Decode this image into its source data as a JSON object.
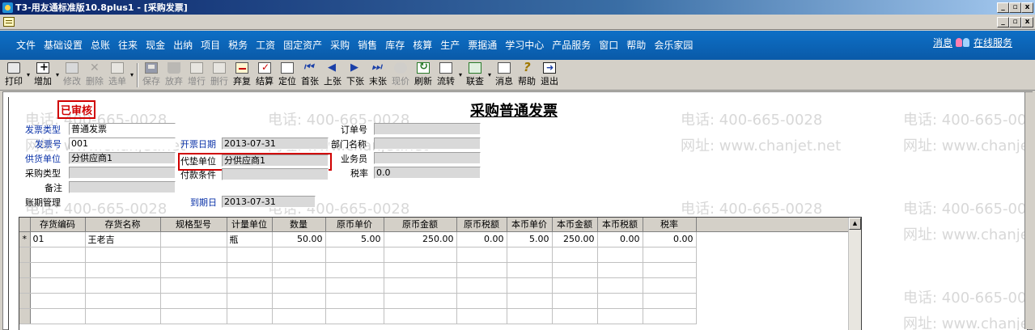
{
  "window": {
    "title": "T3-用友通标准版10.8plus1 - [采购发票]",
    "buttons": [
      "_",
      "▫",
      "x"
    ]
  },
  "inner_window": {
    "buttons": [
      "_",
      "▫",
      "x"
    ]
  },
  "menu": {
    "items": [
      "文件",
      "基础设置",
      "总账",
      "往来",
      "现金",
      "出纳",
      "项目",
      "税务",
      "工资",
      "固定资产",
      "采购",
      "销售",
      "库存",
      "核算",
      "生产",
      "票据通",
      "学习中心",
      "产品服务",
      "窗口",
      "帮助",
      "会乐家园"
    ],
    "message": "消息",
    "online_service": "在线服务"
  },
  "toolbar": {
    "print": "打印",
    "add": "增加",
    "modify": "修改",
    "delete": "删除",
    "select": "选单",
    "save": "保存",
    "discard": "放弃",
    "add_row": "增行",
    "delete_row": "删行",
    "abandon": "弃复",
    "settle": "结算",
    "locate": "定位",
    "first": "首张",
    "prev": "上张",
    "next": "下张",
    "last": "末张",
    "stock": "现价",
    "refresh": "刷新",
    "flow": "流转",
    "query": "联查",
    "message": "消息",
    "help": "帮助",
    "exit": "退出"
  },
  "watermark": {
    "phone": "电话: 400-665-0028",
    "site": "网址: www.chanjet.net"
  },
  "form": {
    "status_stamp": "已审核",
    "title": "采购普通发票",
    "invoice_type_label": "发票类型",
    "invoice_type": "普通发票",
    "invoice_no_label": "发票号",
    "invoice_no": "001",
    "supplier_label": "供货单位",
    "supplier": "分供应商1",
    "purchase_type_label": "采购类型",
    "purchase_type": "",
    "remark_label": "备注",
    "remark": "",
    "account_period_label": "账期管理",
    "invoice_date_label": "开票日期",
    "invoice_date": "2013-07-31",
    "payer_label": "代垫单位",
    "payer": "分供应商1",
    "payment_terms_label": "付款条件",
    "payment_terms": "",
    "due_date_label": "到期日",
    "due_date": "2013-07-31",
    "order_no_label": "订单号",
    "order_no": "",
    "department_label": "部门名称",
    "department": "",
    "salesman_label": "业务员",
    "salesman": "",
    "tax_rate_label": "税率",
    "tax_rate": "0.0"
  },
  "grid": {
    "columns": [
      "存货编码",
      "存货名称",
      "规格型号",
      "计量单位",
      "数量",
      "原币单价",
      "原币金额",
      "原币税额",
      "本币单价",
      "本币金额",
      "本币税额",
      "税率"
    ],
    "rows": [
      {
        "marker": "*",
        "cells": [
          "01",
          "王老吉",
          "",
          "瓶",
          "50.00",
          "5.00",
          "250.00",
          "0.00",
          "5.00",
          "250.00",
          "0.00",
          "0.00"
        ]
      }
    ]
  }
}
